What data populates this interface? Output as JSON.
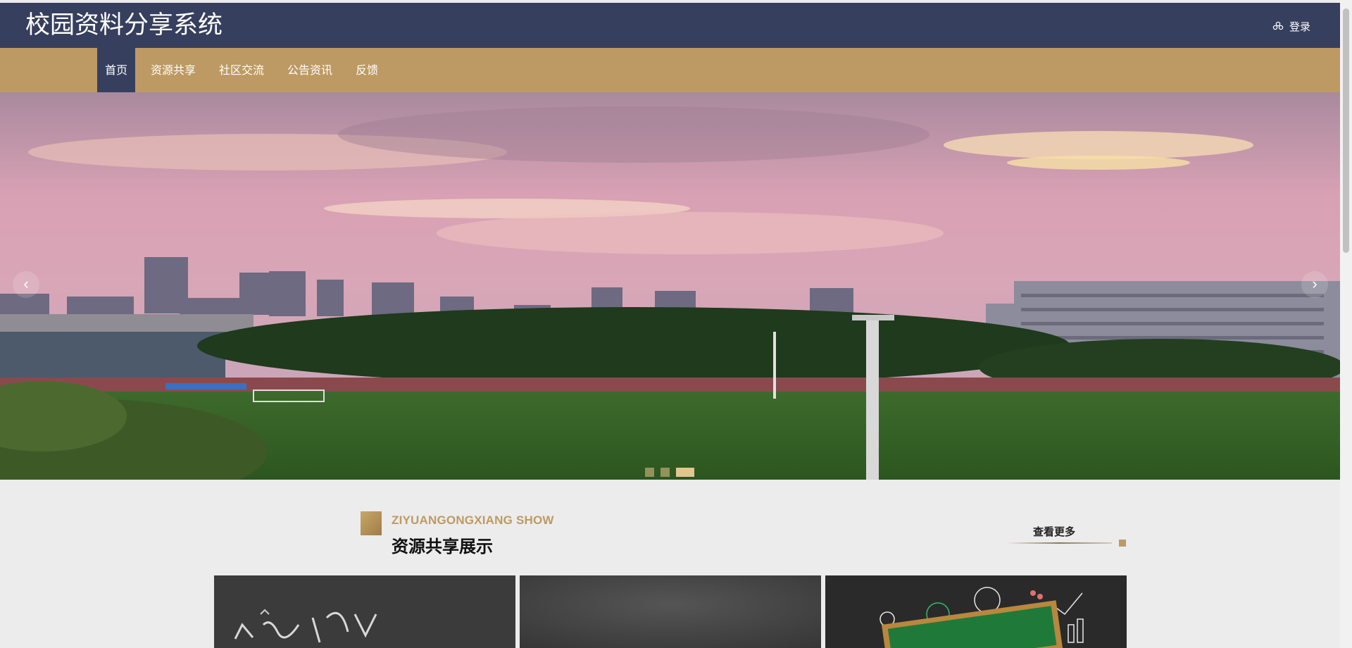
{
  "header": {
    "site_title": "校园资料分享系统",
    "login_label": "登录",
    "login_icon": "users-icon"
  },
  "nav": {
    "items": [
      {
        "label": "首页",
        "active": true
      },
      {
        "label": "资源共享",
        "active": false
      },
      {
        "label": "社区交流",
        "active": false
      },
      {
        "label": "公告资讯",
        "active": false
      },
      {
        "label": "反馈",
        "active": false
      }
    ]
  },
  "carousel": {
    "prev_label": "‹",
    "next_label": "›",
    "slide_count": 3,
    "active_slide": 3
  },
  "section": {
    "subtitle_en": "ZIYUANGONGXIANG SHOW",
    "title_cn": "资源共享展示",
    "more_label": "查看更多"
  },
  "colors": {
    "header_bg": "#373f5e",
    "nav_bg": "#bd9a63",
    "accent": "#bd9a63",
    "page_bg": "#ececec"
  }
}
